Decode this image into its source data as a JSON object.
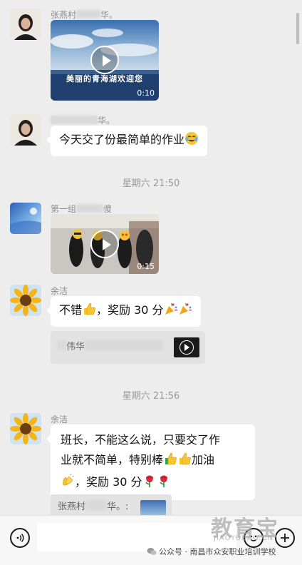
{
  "messages": [
    {
      "sender_prefix": "张燕村",
      "sender_suffix": "华。",
      "video_caption": "美丽的青海湖欢迎您",
      "duration": "0:10"
    },
    {
      "sender_suffix": "华。",
      "text": "今天交了份最简单的作业",
      "emoji_icon": "tears-of-joy-emoji"
    },
    {
      "sender_prefix": "第一组",
      "sender_suffix": "傻",
      "duration": "0:15"
    },
    {
      "sender": "余洁",
      "text_part1": "不错",
      "text_part2": "，奖励 30 分",
      "quote_name": "伟华"
    },
    {
      "sender": "余洁",
      "text_line1": "班长，不能这么说，只要交了作",
      "text_line2": "业就不简单，特别棒",
      "text_line2b": "加油",
      "text_line3": "，奖励 30 分",
      "quote_prefix": "张燕村",
      "quote_suffix": "华。:"
    }
  ],
  "timestamps": [
    "星期六 21:50",
    "星期六 21:56"
  ],
  "watermark": {
    "logo": "教育宝",
    "domain": "JIAOYUBAO.CN",
    "footer": "公众号 · 南昌市众安职业培训学校"
  },
  "colors": {
    "background": "#ededed",
    "bubble": "#ffffff",
    "quote": "#e2e2e2",
    "timestamp": "#999999"
  }
}
